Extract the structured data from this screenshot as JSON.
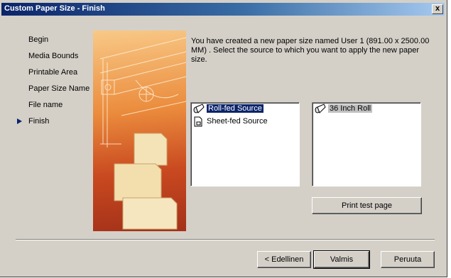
{
  "window": {
    "title": "Custom Paper Size - Finish",
    "close_label": "x"
  },
  "steps": [
    {
      "label": "Begin"
    },
    {
      "label": "Media Bounds"
    },
    {
      "label": "Printable Area"
    },
    {
      "label": "Paper Size Name"
    },
    {
      "label": "File name"
    },
    {
      "label": "Finish",
      "current": true
    }
  ],
  "message": "You have created a new paper size named User 1 (891.00 x 2500.00 MM) . Select the source to which you want to apply the new paper size.",
  "source_list": {
    "items": [
      {
        "label": "Roll-fed Source",
        "icon": "roll-feed-icon",
        "selected": true
      },
      {
        "label": "Sheet-fed Source",
        "icon": "sheet-feed-icon",
        "selected": false
      }
    ]
  },
  "roll_list": {
    "items": [
      {
        "label": "36 Inch Roll",
        "icon": "roll-icon"
      }
    ]
  },
  "buttons": {
    "print_test": "Print test page",
    "back": "< Edellinen",
    "finish": "Valmis",
    "cancel": "Peruuta"
  },
  "colors": {
    "titlebar_start": "#0a246a",
    "titlebar_end": "#a6caf0",
    "dialog_face": "#d4d0c8",
    "selection": "#0a246a",
    "illustration_orange": "#eb8c3d"
  }
}
